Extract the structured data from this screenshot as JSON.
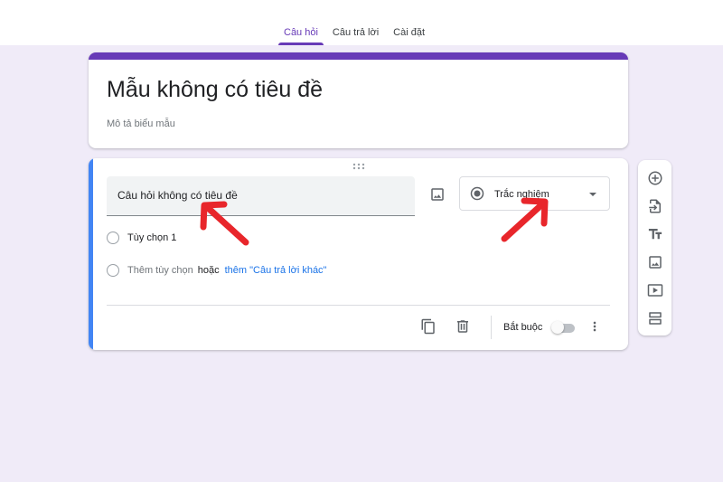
{
  "tabs": [
    {
      "label": "Câu hỏi",
      "active": true
    },
    {
      "label": "Câu trả lời",
      "active": false
    },
    {
      "label": "Cài đặt",
      "active": false
    }
  ],
  "form": {
    "title": "Mẫu không có tiêu đề",
    "description_placeholder": "Mô tả biểu mẫu"
  },
  "question": {
    "title": "Câu hỏi không có tiêu đề",
    "type": "Trắc nghiệm",
    "options": [
      "Tùy chọn 1"
    ],
    "add_option": "Thêm tùy chọn",
    "or": "hoặc",
    "add_other": "thêm \"Câu trả lời khác\"",
    "required_label": "Bắt buộc",
    "required": false
  },
  "side_toolbar": [
    "add-question-icon",
    "import-questions-icon",
    "add-title-icon",
    "add-image-icon",
    "add-video-icon",
    "add-section-icon"
  ],
  "colors": {
    "accent": "#673ab7",
    "background": "#f0ebf8",
    "active_card_stripe": "#4285f4",
    "link": "#1a73e8",
    "annotation_arrow": "#e8262b"
  }
}
